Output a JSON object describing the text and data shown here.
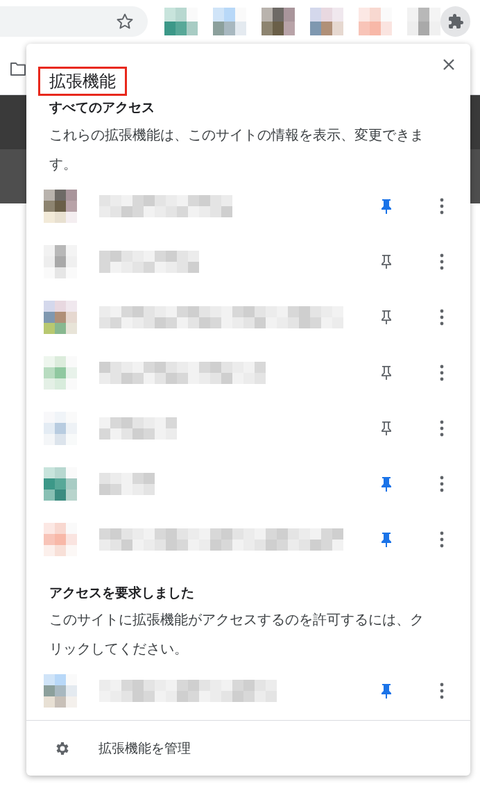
{
  "popup": {
    "title": "拡張機能",
    "sections": [
      {
        "heading": "すべてのアクセス",
        "description": "これらの拡張機能は、このサイトの情報を表示、変更できます。",
        "extensions": [
          {
            "pinned": true
          },
          {
            "pinned": false
          },
          {
            "pinned": false
          },
          {
            "pinned": false
          },
          {
            "pinned": false
          },
          {
            "pinned": true
          },
          {
            "pinned": true
          }
        ]
      },
      {
        "heading": "アクセスを要求しました",
        "description": "このサイトに拡張機能がアクセスするのを許可するには、クリックしてください。",
        "extensions": [
          {
            "pinned": true
          }
        ]
      }
    ],
    "footer": {
      "label": "拡張機能を管理"
    }
  }
}
